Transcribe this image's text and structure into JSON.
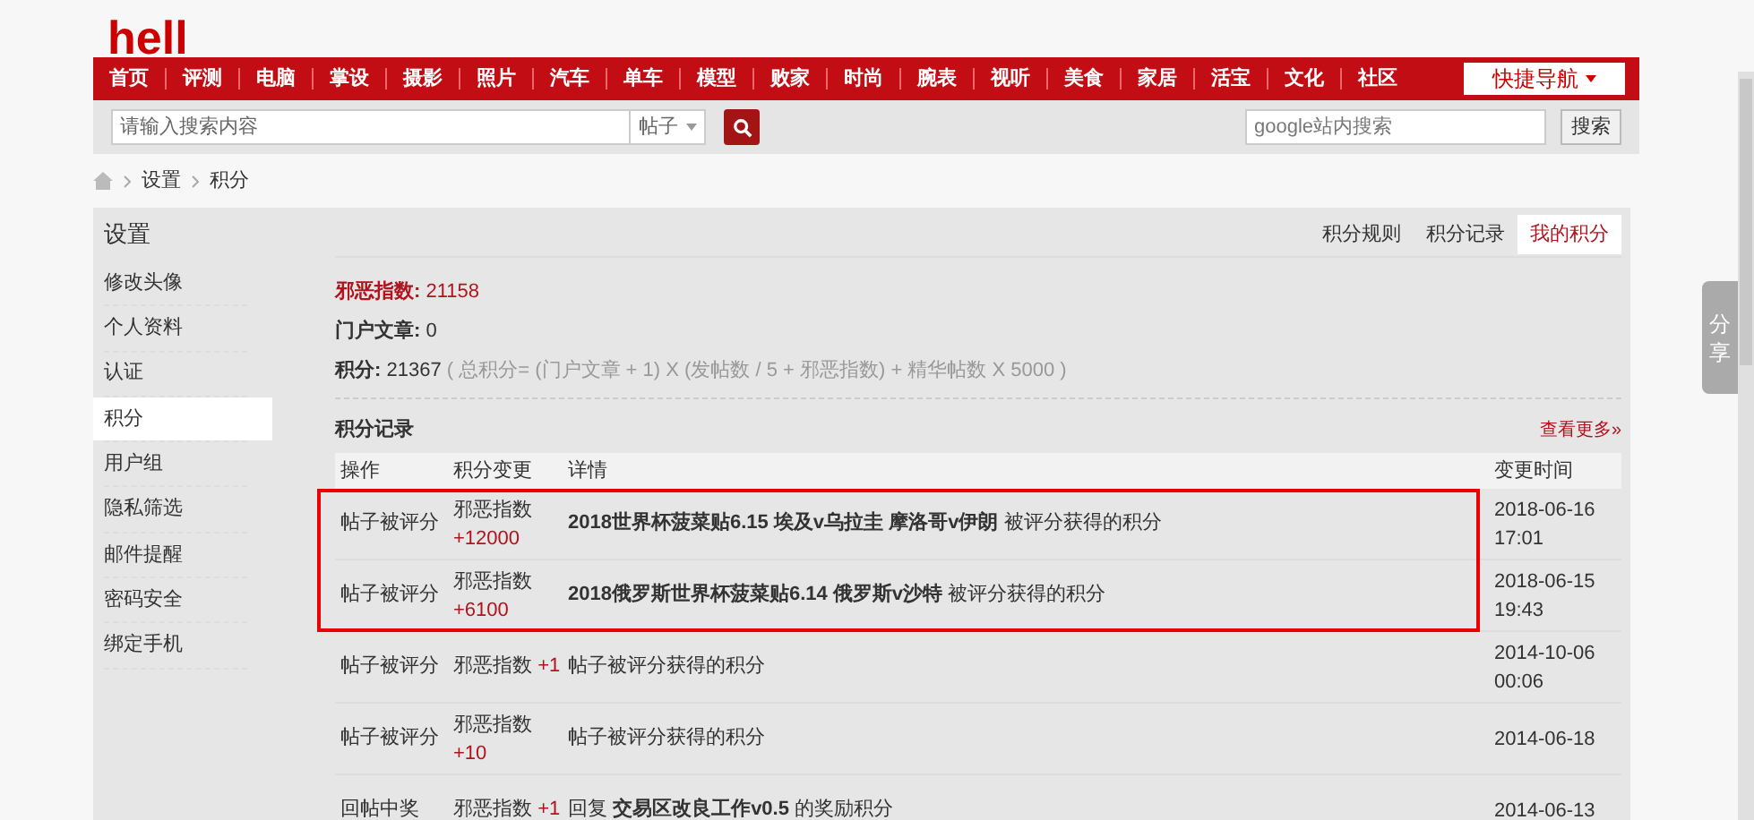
{
  "logo": {
    "text": "hell"
  },
  "nav": {
    "items": [
      {
        "label": "首页"
      },
      {
        "label": "评测"
      },
      {
        "label": "电脑"
      },
      {
        "label": "掌设"
      },
      {
        "label": "摄影"
      },
      {
        "label": "照片"
      },
      {
        "label": "汽车"
      },
      {
        "label": "单车"
      },
      {
        "label": "模型"
      },
      {
        "label": "败家"
      },
      {
        "label": "时尚"
      },
      {
        "label": "腕表"
      },
      {
        "label": "视听"
      },
      {
        "label": "美食"
      },
      {
        "label": "家居"
      },
      {
        "label": "活宝"
      },
      {
        "label": "文化"
      },
      {
        "label": "社区"
      }
    ],
    "quick_nav": "快捷导航"
  },
  "search": {
    "placeholder": "请输入搜索内容",
    "type": "帖子",
    "google_placeholder": "google站内搜索",
    "google_button": "搜索"
  },
  "breadcrumb": [
    "设置",
    "积分"
  ],
  "sidebar": {
    "title": "设置",
    "items": [
      {
        "label": "修改头像",
        "selected": false
      },
      {
        "label": "个人资料",
        "selected": false
      },
      {
        "label": "认证",
        "selected": false
      },
      {
        "label": "积分",
        "selected": true
      },
      {
        "label": "用户组",
        "selected": false
      },
      {
        "label": "隐私筛选",
        "selected": false
      },
      {
        "label": "邮件提醒",
        "selected": false
      },
      {
        "label": "密码安全",
        "selected": false
      },
      {
        "label": "绑定手机",
        "selected": false
      }
    ]
  },
  "tabs": [
    {
      "label": "积分规则",
      "selected": false
    },
    {
      "label": "积分记录",
      "selected": false
    },
    {
      "label": "我的积分",
      "selected": true
    }
  ],
  "stats": {
    "evil_label": "邪恶指数:",
    "evil_value": "21158",
    "articles_label": "门户文章:",
    "articles_value": "0",
    "points_label": "积分:",
    "points_value": "21367",
    "formula": "( 总积分= (门户文章 + 1) X (发帖数 / 5 + 邪恶指数) + 精华帖数 X 5000 )"
  },
  "records": {
    "title": "积分记录",
    "more": "查看更多»",
    "columns": [
      "操作",
      "积分变更",
      "详情",
      "变更时间"
    ],
    "rows": [
      {
        "action": "帖子被评分",
        "change_label": "邪恶指数",
        "change_value": "+12000",
        "stacked": true,
        "detail": "**2018世界杯菠菜贴6.15 埃及v乌拉圭 摩洛哥v伊朗** 被评分获得的积分",
        "date": "2018-06-16",
        "time": "17:01",
        "highlighted": true
      },
      {
        "action": "帖子被评分",
        "change_label": "邪恶指数",
        "change_value": "+6100",
        "stacked": true,
        "detail": "**2018俄罗斯世界杯菠菜贴6.14 俄罗斯v沙特** 被评分获得的积分",
        "date": "2018-06-15",
        "time": "19:43",
        "highlighted": true
      },
      {
        "action": "帖子被评分",
        "change_label": "邪恶指数",
        "change_value": "+1",
        "stacked": false,
        "detail": "帖子被评分获得的积分",
        "date": "2014-10-06",
        "time": "00:06",
        "highlighted": false
      },
      {
        "action": "帖子被评分",
        "change_label": "邪恶指数",
        "change_value": "+10",
        "stacked": true,
        "detail": "帖子被评分获得的积分",
        "date": "2014-06-18",
        "highlighted": false
      },
      {
        "action": "回帖中奖",
        "change_label": "邪恶指数",
        "change_value": "+1",
        "stacked": false,
        "detail": "回复 **交易区改良工作v0.5** 的奖励积分",
        "date": "2014-06-13",
        "highlighted": false
      }
    ]
  },
  "share": {
    "label": "分享"
  }
}
